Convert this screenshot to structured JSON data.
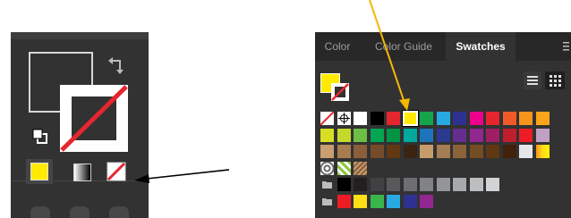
{
  "swatches_panel": {
    "tabs": [
      {
        "label": "Color"
      },
      {
        "label": "Color Guide"
      },
      {
        "label": "Swatches"
      }
    ],
    "active_tab": "Swatches",
    "icons": [
      "hamburger-menu-icon",
      "list-view-icon",
      "grid-view-icon",
      "collapse-double-arrow-icon"
    ],
    "current_fill": "#ffea00",
    "rows": [
      [
        "none",
        "registration",
        "#ffffff",
        "#000000",
        "#e6262e",
        "yellow-selected",
        "#14a54a",
        "#27a9e1",
        "#2e3192",
        "#ec008c",
        "#e6262e",
        "#f05a28",
        "#f7941d",
        "#f9a51a"
      ],
      [
        "#d7df23",
        "#c5d92d",
        "#6ebe45",
        "#00a651",
        "#009444",
        "#00a99d",
        "#1c75bc",
        "#2b3990",
        "#662d91",
        "#92278f",
        "#9e1f63",
        "#be1e2d",
        "#ed1c24",
        "#c2a0c4"
      ],
      [
        "#c99e70",
        "#a97c50",
        "#8b5e3c",
        "#754c29",
        "#603913",
        "#3c2415",
        "#c69c6d",
        "#a67c52",
        "#8c6239",
        "#754c24",
        "#603813",
        "#42210b",
        "#e6e7e8",
        "gold-gradient"
      ],
      [
        "pattern",
        "pattern",
        "pattern"
      ],
      [
        "folder",
        "#000000",
        "#231f20",
        "#414042",
        "#58595b",
        "#6d6e71",
        "#808285",
        "#939598",
        "#a7a9ac",
        "#bcbec0",
        "#d1d3d4"
      ],
      [
        "folder",
        "#ed1c24",
        "#ffde17",
        "#39b54a",
        "#27aae1",
        "#2e3192",
        "#92278f"
      ]
    ]
  },
  "tools_panel": {
    "fill_color": "#ffea00",
    "stroke": "none",
    "modes": [
      "color",
      "gradient",
      "none"
    ],
    "icons": [
      "swap-fill-stroke-icon",
      "default-fill-stroke-icon"
    ]
  },
  "annotation": {
    "arrow_color_yellow": "#f5b800",
    "arrow_color_black": "#000000"
  }
}
